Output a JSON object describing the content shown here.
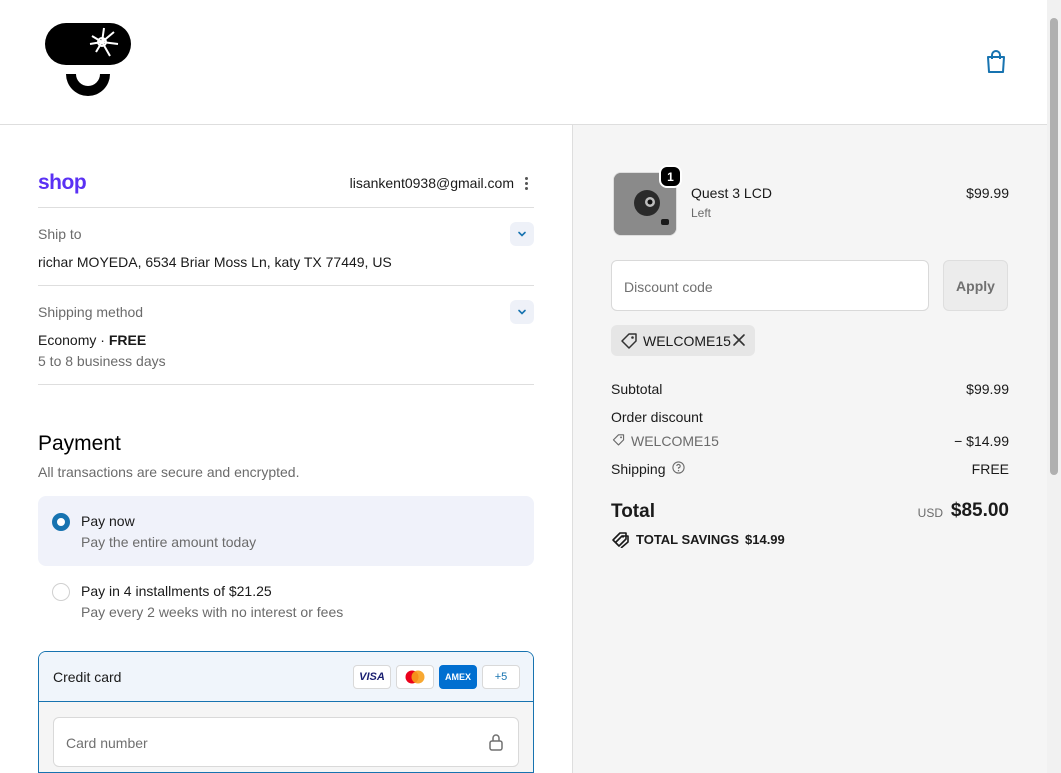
{
  "header": {
    "logo_name": "brand-logo",
    "cart_icon": "shopping-bag-icon"
  },
  "account": {
    "shop_logo": "shop",
    "email": "lisankent0938@gmail.com"
  },
  "ship_to": {
    "label": "Ship to",
    "value": "richar MOYEDA, 6534 Briar Moss Ln, katy TX 77449, US"
  },
  "shipping_method": {
    "label": "Shipping method",
    "name": "Economy · ",
    "price": "FREE",
    "eta": "5 to 8 business days"
  },
  "payment": {
    "title": "Payment",
    "subtitle": "All transactions are secure and encrypted.",
    "options": [
      {
        "title": "Pay now",
        "sub": "Pay the entire amount today",
        "selected": true
      },
      {
        "title": "Pay in 4 installments of $21.25",
        "sub": "Pay every 2 weeks with no interest or fees",
        "selected": false
      }
    ],
    "credit_card": {
      "label": "Credit card",
      "brands": [
        "VISA",
        "MC",
        "AMEX",
        "+5"
      ],
      "card_number_placeholder": "Card number"
    }
  },
  "order": {
    "item": {
      "quantity": "1",
      "name": "Quest 3 LCD",
      "variant": "Left",
      "price": "$99.99"
    },
    "discount": {
      "placeholder": "Discount code",
      "apply_label": "Apply",
      "applied_code": "WELCOME15"
    },
    "summary": {
      "subtotal_label": "Subtotal",
      "subtotal_value": "$99.99",
      "order_discount_label": "Order discount",
      "discount_code": "WELCOME15",
      "discount_value": "− $14.99",
      "shipping_label": "Shipping",
      "shipping_value": "FREE",
      "total_label": "Total",
      "currency": "USD",
      "total_value": "$85.00",
      "savings_label": "TOTAL SAVINGS",
      "savings_value": "$14.99"
    }
  },
  "colors": {
    "accent": "#1773b0",
    "shop_purple": "#5a31f4",
    "summary_bg": "#f5f5f5"
  }
}
